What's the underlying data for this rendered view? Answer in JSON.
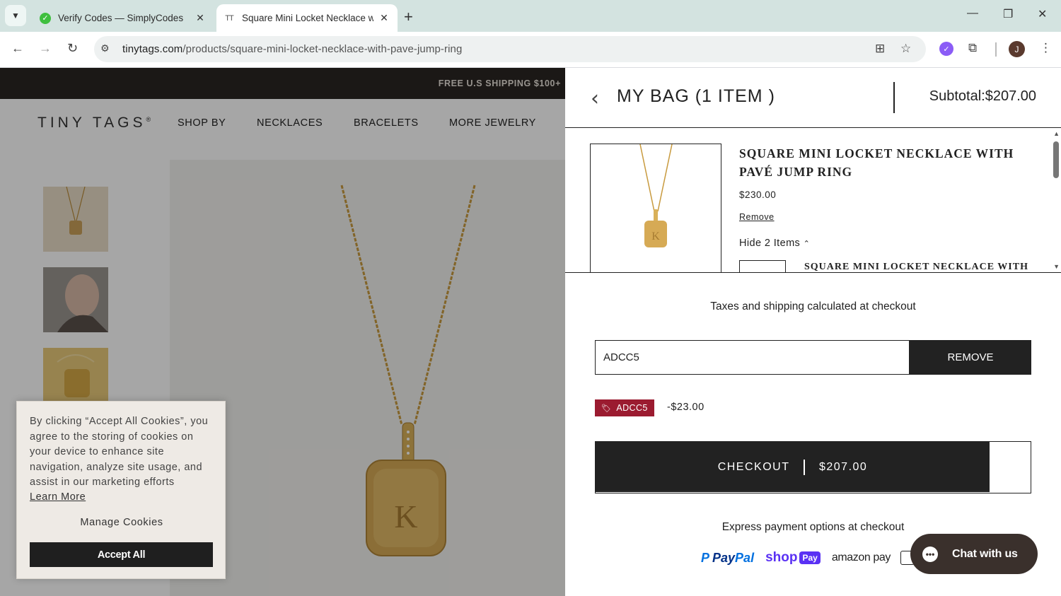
{
  "browser": {
    "tabs": [
      {
        "title": "Verify Codes — SimplyCodes",
        "favicon": "simplycodes-icon"
      },
      {
        "title": "Square Mini Locket Necklace wi",
        "favicon": "TT"
      }
    ],
    "url_domain": "tinytags.com",
    "url_path": "/products/square-mini-locket-necklace-with-pave-jump-ring",
    "profile_initial": "J"
  },
  "site": {
    "promo": "FREE U.S SHIPPING $100+",
    "logo": "TINY TAGS",
    "logo_mark": "®",
    "nav": [
      "SHOP BY",
      "NECKLACES",
      "BRACELETS",
      "MORE JEWELRY"
    ],
    "hero_engraving": "K"
  },
  "cookie": {
    "text": "By clicking “Accept All Cookies”, you agree to the storing of cookies on your device to enhance site navigation, analyze site usage, and assist in our marketing efforts",
    "learn_more": "Learn More",
    "manage": "Manage Cookies",
    "accept": "Accept All"
  },
  "cart": {
    "title": "MY BAG (1 ITEM )",
    "subtotal": "Subtotal:$207.00",
    "item": {
      "name": "SQUARE MINI LOCKET NECKLACE WITH PAVÉ JUMP RING",
      "price": "$230.00",
      "remove": "Remove",
      "hide_items": "Hide 2 Items",
      "sub_name": "SQUARE MINI LOCKET NECKLACE WITH",
      "engraving": "K"
    },
    "taxes_note": "Taxes and shipping calculated at checkout",
    "discount_code_value": "ADCC5",
    "remove_button": "REMOVE",
    "discount_badge": "ADCC5",
    "discount_amount": "-$23.00",
    "checkout_label": "CHECKOUT",
    "checkout_total": "$207.00",
    "express_note": "Express payment options at checkout",
    "payments": {
      "paypal_a": "Pay",
      "paypal_b": "Pal",
      "shop": "shop",
      "shop_pay": "Pay",
      "amazon": "amazon pay"
    }
  },
  "chat": {
    "label": "Chat with us"
  }
}
